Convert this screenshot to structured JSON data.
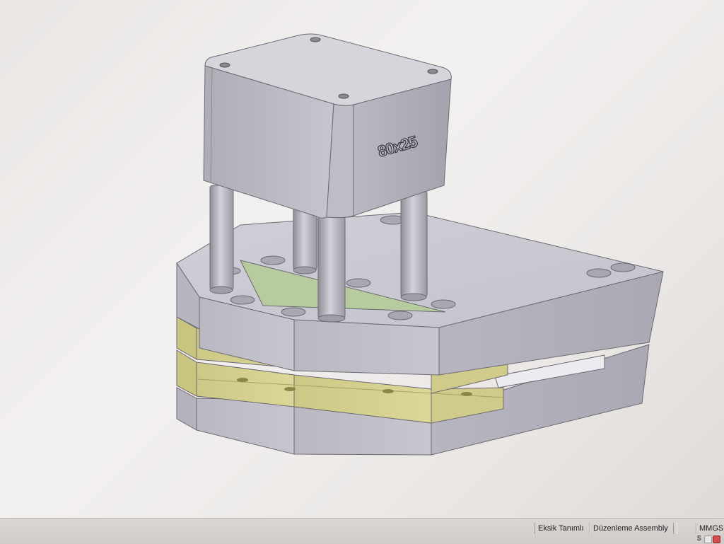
{
  "model": {
    "engraving": "80x25"
  },
  "status_bar": {
    "missing_definition": "Eksik Tanımlı",
    "edit_mode": "Düzenleme Assembly",
    "blank": "",
    "units": "MMGS"
  },
  "colors": {
    "background": "#efedec",
    "steel": "#c2c1c9",
    "brass": "#d4cf8a",
    "die_cavity": "#b6cc9e"
  },
  "icons": [
    "dollar-icon",
    "status-indicator-icon",
    "status-indicator-red-icon"
  ]
}
